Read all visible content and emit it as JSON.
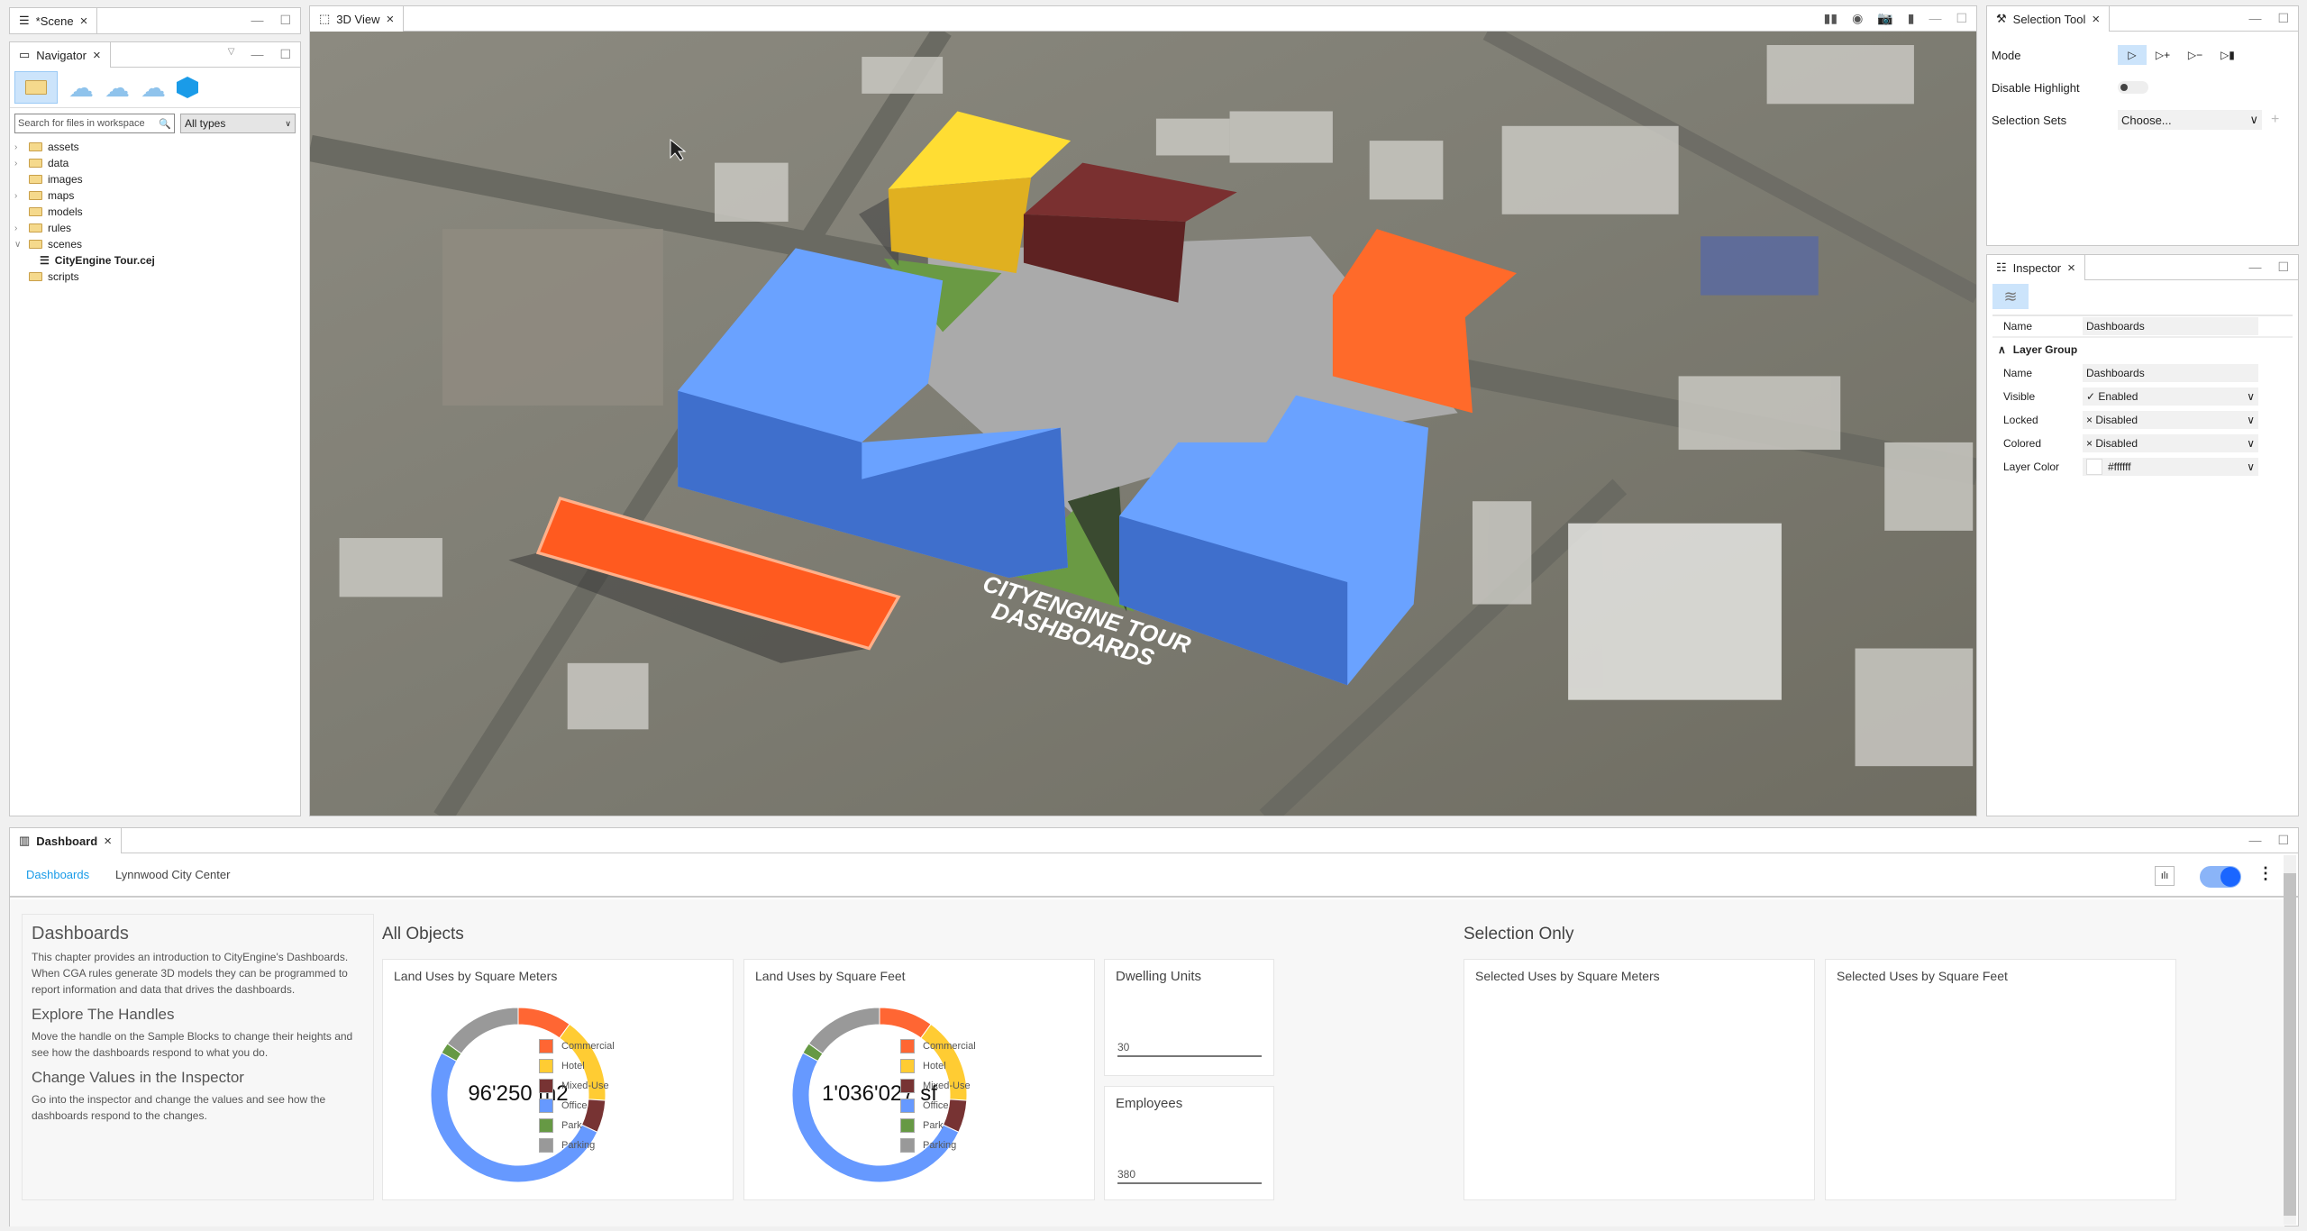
{
  "scene_panel": {
    "tab": "*Scene"
  },
  "navigator": {
    "tab": "Navigator",
    "search_placeholder": "Search for files in workspace",
    "type_filter": "All types",
    "tree": [
      {
        "label": "assets",
        "expandable": true
      },
      {
        "label": "data",
        "expandable": true
      },
      {
        "label": "images",
        "expandable": false
      },
      {
        "label": "maps",
        "expandable": true
      },
      {
        "label": "models",
        "expandable": false
      },
      {
        "label": "rules",
        "expandable": true
      },
      {
        "label": "scenes",
        "expandable": true,
        "expanded": true
      },
      {
        "label": "CityEngine Tour.cej",
        "child": true
      },
      {
        "label": "scripts",
        "expandable": false
      }
    ],
    "toolbar_icons": [
      "folder-icon",
      "cloud-user-icon",
      "cloud-group-icon",
      "cloud-icon",
      "arcgis-urban-icon"
    ]
  },
  "view3d": {
    "tab": "3D View",
    "toolbar_icons": [
      "layers-icon",
      "eye-icon",
      "camera-icon",
      "bookmark-icon"
    ],
    "sign_text": [
      "CITYENGINE TOUR",
      "DASHBOARDS"
    ]
  },
  "selection_tool": {
    "tab": "Selection Tool",
    "mode_label": "Mode",
    "disable_highlight_label": "Disable Highlight",
    "disable_highlight_on": false,
    "selection_sets_label": "Selection Sets",
    "selection_sets_value": "Choose..."
  },
  "inspector": {
    "tab": "Inspector",
    "name_label": "Name",
    "name_value": "Dashboards",
    "group_title": "Layer Group",
    "rows": [
      {
        "label": "Name",
        "value": "Dashboards"
      },
      {
        "label": "Visible",
        "value": "✓ Enabled"
      },
      {
        "label": "Locked",
        "value": "× Disabled"
      },
      {
        "label": "Colored",
        "value": "× Disabled"
      },
      {
        "label": "Layer Color",
        "value": "#ffffff"
      }
    ]
  },
  "dashboard": {
    "tab": "Dashboard",
    "subtabs": [
      "Dashboards",
      "Lynnwood City Center"
    ],
    "active_subtab": "Dashboards",
    "intro": {
      "title": "Dashboards",
      "p1": "This chapter provides an introduction to CityEngine's Dashboards. When CGA rules generate 3D models they can be programmed to report information and data that drives the dashboards.",
      "h2": "Explore The Handles",
      "p2": "Move the handle on the Sample Blocks to change their heights and see how the dashboards respond to what you do.",
      "h3": "Change Values in the Inspector",
      "p3": "Go into the inspector and change the values and see how the dashboards respond to the changes."
    },
    "all_objects": "All Objects",
    "selection_only": "Selection Only",
    "charts": [
      {
        "type": "pie",
        "title": "Land Uses by Square Meters",
        "total_label": "96'250 m2"
      },
      {
        "type": "pie",
        "title": "Land Uses by Square Feet",
        "total_label": "1'036'027 sf"
      }
    ],
    "dwelling_units": {
      "title": "Dwelling Units",
      "value": "30"
    },
    "employees": {
      "title": "Employees",
      "value": "380"
    },
    "selected_charts": [
      "Selected Uses by Square Meters",
      "Selected Uses by Square Feet"
    ],
    "sync_toggle_on": true
  },
  "chart_data": {
    "type": "pie",
    "categories": [
      "Commercial",
      "Hotel",
      "Mixed-Use",
      "Office",
      "Park",
      "Parking"
    ],
    "values": [
      10,
      16,
      6,
      51,
      2,
      15
    ],
    "colors": [
      "#ff6633",
      "#ffcc33",
      "#773333",
      "#6699ff",
      "#669944",
      "#999999"
    ]
  }
}
